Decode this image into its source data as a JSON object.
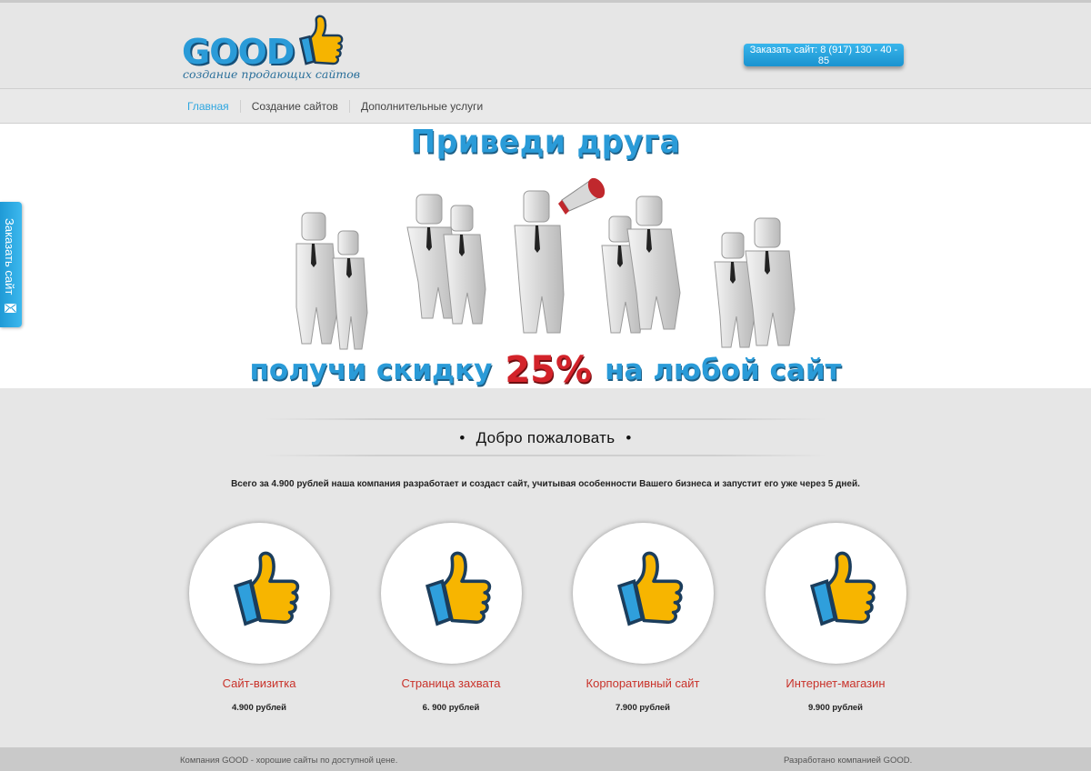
{
  "header": {
    "logo_word": "GOOD",
    "logo_tagline": "создание продающих сайтов",
    "order_button": "Заказать сайт: 8 (917) 130 - 40 - 85"
  },
  "nav": {
    "items": [
      {
        "label": "Главная",
        "active": true
      },
      {
        "label": "Создание сайтов",
        "active": false
      },
      {
        "label": "Дополнительные услуги",
        "active": false
      }
    ]
  },
  "hero": {
    "title": "Приведи друга",
    "sub_before": "получи скидку",
    "sub_percent": "25%",
    "sub_after": "на любой  сайт"
  },
  "side_tab": {
    "label": "Заказать сайт",
    "icon": "envelope-icon"
  },
  "welcome": {
    "dot": "•",
    "title": "Добро пожаловать"
  },
  "intro": {
    "text": "Всего за 4.900 рублей наша компания разработает и создаст сайт, учитывая особенности Вашего бизнеса и запустит его уже через 5 дней."
  },
  "products": [
    {
      "title": "Сайт-визитка",
      "price": "4.900 рублей",
      "icon": "thumbs-up-icon"
    },
    {
      "title": "Страница захвата",
      "price": "6. 900 рублей",
      "icon": "thumbs-up-icon"
    },
    {
      "title": "Корпоративный сайт",
      "price": "7.900 рублей",
      "icon": "thumbs-up-icon"
    },
    {
      "title": "Интернет-магазин",
      "price": "9.900 рублей",
      "icon": "thumbs-up-icon"
    }
  ],
  "footer": {
    "left": "Компания GOOD - хорошие сайты по доступной цене.",
    "right": "Разработано компанией GOOD."
  },
  "colors": {
    "accent_blue": "#2a9bd8",
    "accent_red": "#c9322a",
    "thumb_yellow": "#f7b500"
  }
}
